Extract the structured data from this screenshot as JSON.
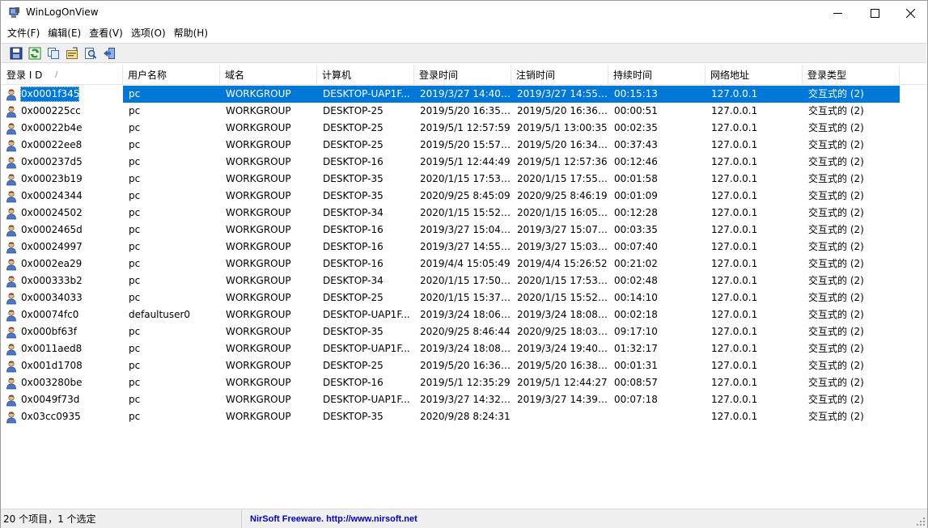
{
  "window": {
    "title": "WinLogOnView"
  },
  "menu": [
    "文件(F)",
    "编辑(E)",
    "查看(V)",
    "选项(O)",
    "帮助(H)"
  ],
  "toolbar": [
    "save-icon",
    "refresh-icon",
    "copy-icon",
    "properties-icon",
    "find-icon",
    "exit-icon"
  ],
  "columns": [
    "登录 I D",
    "用户名称",
    "域名",
    "计算机",
    "登录时间",
    "注销时间",
    "持续时间",
    "网络地址",
    "登录类型"
  ],
  "rows": [
    [
      "0x0001f345",
      "pc",
      "WORKGROUP",
      "DESKTOP-UAP1F...",
      "2019/3/27 14:40:...",
      "2019/3/27 14:55:...",
      "00:15:13",
      "127.0.0.1",
      "交互式的 (2)"
    ],
    [
      "0x000225cc",
      "pc",
      "WORKGROUP",
      "DESKTOP-25",
      "2019/5/20 16:35:...",
      "2019/5/20 16:36:...",
      "00:00:51",
      "127.0.0.1",
      "交互式的 (2)"
    ],
    [
      "0x00022b4e",
      "pc",
      "WORKGROUP",
      "DESKTOP-25",
      "2019/5/1 12:57:59",
      "2019/5/1 13:00:35",
      "00:02:35",
      "127.0.0.1",
      "交互式的 (2)"
    ],
    [
      "0x00022ee8",
      "pc",
      "WORKGROUP",
      "DESKTOP-25",
      "2019/5/20 15:57:...",
      "2019/5/20 16:34:...",
      "00:37:43",
      "127.0.0.1",
      "交互式的 (2)"
    ],
    [
      "0x000237d5",
      "pc",
      "WORKGROUP",
      "DESKTOP-16",
      "2019/5/1 12:44:49",
      "2019/5/1 12:57:36",
      "00:12:46",
      "127.0.0.1",
      "交互式的 (2)"
    ],
    [
      "0x00023b19",
      "pc",
      "WORKGROUP",
      "DESKTOP-35",
      "2020/1/15 17:53:...",
      "2020/1/15 17:55:...",
      "00:01:58",
      "127.0.0.1",
      "交互式的 (2)"
    ],
    [
      "0x00024344",
      "pc",
      "WORKGROUP",
      "DESKTOP-35",
      "2020/9/25 8:45:09",
      "2020/9/25 8:46:19",
      "00:01:09",
      "127.0.0.1",
      "交互式的 (2)"
    ],
    [
      "0x00024502",
      "pc",
      "WORKGROUP",
      "DESKTOP-34",
      "2020/1/15 15:52:...",
      "2020/1/15 16:05:...",
      "00:12:28",
      "127.0.0.1",
      "交互式的 (2)"
    ],
    [
      "0x0002465d",
      "pc",
      "WORKGROUP",
      "DESKTOP-16",
      "2019/3/27 15:04:...",
      "2019/3/27 15:07:...",
      "00:03:35",
      "127.0.0.1",
      "交互式的 (2)"
    ],
    [
      "0x00024997",
      "pc",
      "WORKGROUP",
      "DESKTOP-16",
      "2019/3/27 14:55:...",
      "2019/3/27 15:03:...",
      "00:07:40",
      "127.0.0.1",
      "交互式的 (2)"
    ],
    [
      "0x0002ea29",
      "pc",
      "WORKGROUP",
      "DESKTOP-16",
      "2019/4/4 15:05:49",
      "2019/4/4 15:26:52",
      "00:21:02",
      "127.0.0.1",
      "交互式的 (2)"
    ],
    [
      "0x000333b2",
      "pc",
      "WORKGROUP",
      "DESKTOP-34",
      "2020/1/15 17:50:...",
      "2020/1/15 17:53:...",
      "00:02:48",
      "127.0.0.1",
      "交互式的 (2)"
    ],
    [
      "0x00034033",
      "pc",
      "WORKGROUP",
      "DESKTOP-25",
      "2020/1/15 15:37:...",
      "2020/1/15 15:52:...",
      "00:14:10",
      "127.0.0.1",
      "交互式的 (2)"
    ],
    [
      "0x00074fc0",
      "defaultuser0",
      "WORKGROUP",
      "DESKTOP-UAP1F...",
      "2019/3/24 18:06:...",
      "2019/3/24 18:08:...",
      "00:02:18",
      "127.0.0.1",
      "交互式的 (2)"
    ],
    [
      "0x000bf63f",
      "pc",
      "WORKGROUP",
      "DESKTOP-35",
      "2020/9/25 8:46:44",
      "2020/9/25 18:03:...",
      "09:17:10",
      "127.0.0.1",
      "交互式的 (2)"
    ],
    [
      "0x0011aed8",
      "pc",
      "WORKGROUP",
      "DESKTOP-UAP1F...",
      "2019/3/24 18:08:...",
      "2019/3/24 19:40:...",
      "01:32:17",
      "127.0.0.1",
      "交互式的 (2)"
    ],
    [
      "0x001d1708",
      "pc",
      "WORKGROUP",
      "DESKTOP-25",
      "2019/5/20 16:36:...",
      "2019/5/20 16:38:...",
      "00:01:31",
      "127.0.0.1",
      "交互式的 (2)"
    ],
    [
      "0x003280be",
      "pc",
      "WORKGROUP",
      "DESKTOP-16",
      "2019/5/1 12:35:29",
      "2019/5/1 12:44:27",
      "00:08:57",
      "127.0.0.1",
      "交互式的 (2)"
    ],
    [
      "0x0049f73d",
      "pc",
      "WORKGROUP",
      "DESKTOP-UAP1F...",
      "2019/3/27 14:32:...",
      "2019/3/27 14:39:...",
      "00:07:18",
      "127.0.0.1",
      "交互式的 (2)"
    ],
    [
      "0x03cc0935",
      "pc",
      "WORKGROUP",
      "DESKTOP-35",
      "2020/9/28 8:24:31",
      "",
      "",
      "127.0.0.1",
      "交互式的 (2)"
    ]
  ],
  "selected_row": 0,
  "status": {
    "count_text": "20 个项目，1 个选定",
    "credit_text": "NirSoft Freeware.  http://www.nirsoft.net"
  }
}
